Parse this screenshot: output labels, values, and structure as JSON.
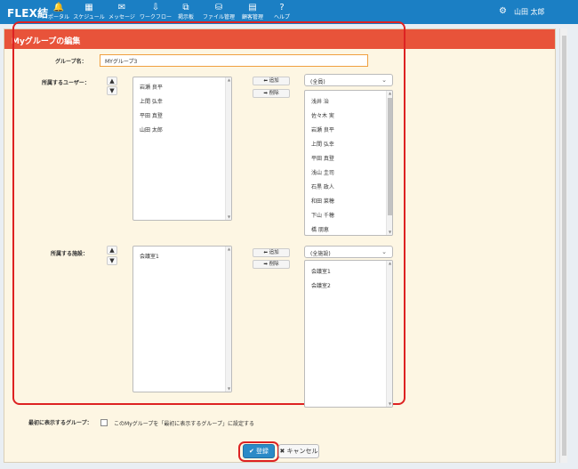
{
  "app": {
    "logo": "FLEX結"
  },
  "nav": [
    {
      "icon": "🔔",
      "label": "ポータル"
    },
    {
      "icon": "▦",
      "label": "スケジュール"
    },
    {
      "icon": "✉",
      "label": "メッセージ"
    },
    {
      "icon": "⇩",
      "label": "ワークフロー"
    },
    {
      "icon": "⧉",
      "label": "掲示板"
    },
    {
      "icon": "⛁",
      "label": "ファイル管理"
    },
    {
      "icon": "▤",
      "label": "顧客管理"
    },
    {
      "icon": "?",
      "label": "ヘルプ"
    }
  ],
  "header": {
    "settings_icon": "⚙",
    "user_name": "山田 太郎"
  },
  "panel": {
    "title": "Myグループの編集"
  },
  "form": {
    "group_name_label": "グループ名：",
    "group_name_value": "MYグループ3",
    "users_label": "所属するユーザー：",
    "members": [
      "岩瀬 良平",
      "上間 弘幸",
      "平田 真登",
      "山田 太郎"
    ],
    "add_label": "⬅ 追加",
    "remove_label": "➡ 削除",
    "user_filter": "(全員)",
    "user_candidates": [
      "浅井 治",
      "佐々木 実",
      "岩瀬 良平",
      "上間 弘幸",
      "平田 真登",
      "浅山 圭司",
      "石黒 政人",
      "和田 菜穂",
      "下山 千穂",
      "橋 朋恵"
    ],
    "facilities_label": "所属する施設：",
    "facility_members": [
      "会議室1"
    ],
    "facility_filter": "(全施設)",
    "facility_candidates": [
      "会議室1",
      "会議室2"
    ],
    "first_show_label": "最初に表示するグループ：",
    "first_show_text": "このMyグループを「最初に表示するグループ」に設定する"
  },
  "actions": {
    "register": "✔ 登録",
    "cancel": "✖ キャンセル"
  }
}
